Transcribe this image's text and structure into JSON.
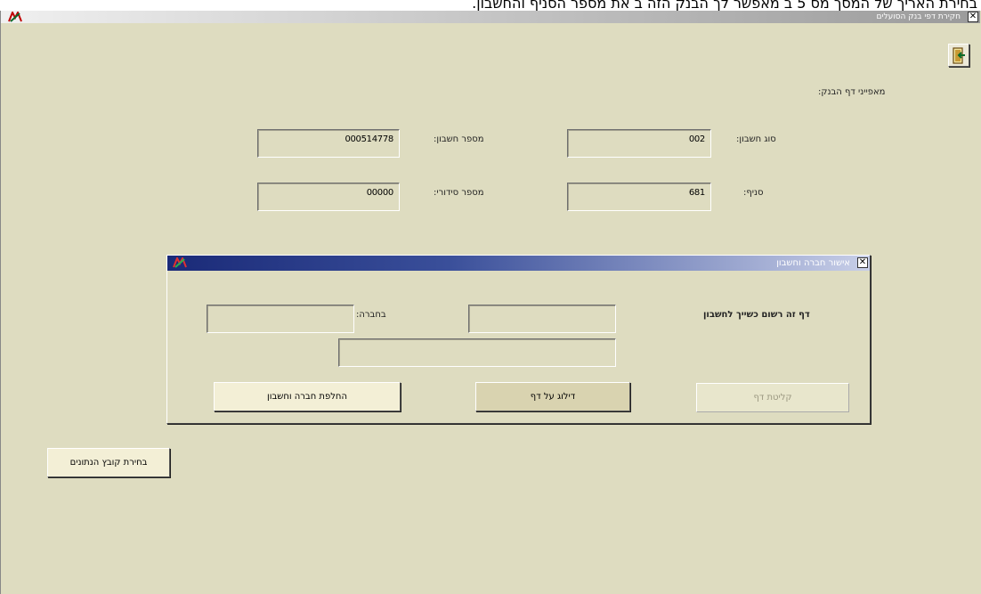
{
  "caption": "בחירת האריך של המסך מס 5 ב מאפשר לך הבנק הזה ב את מספר הסניף והחשבון.",
  "window": {
    "title": "חקירת דפי בנק הסועלים",
    "close_glyph": "✕"
  },
  "section_title": "מאפייני דף הבנק:",
  "fields": {
    "account_type": {
      "label": "סוג חשבון:",
      "value": "002"
    },
    "account_number": {
      "label": "מספר חשבון:",
      "value": "000514778"
    },
    "branch": {
      "label": "סניף:",
      "value": "681"
    },
    "serial_number": {
      "label": "מספר סידורי:",
      "value": "00000"
    }
  },
  "dialog": {
    "title": "אישור חברה וחשבון",
    "close_glyph": "✕",
    "prompt": "דף זה רשום כשייך לחשבון",
    "company_label": "בחברה:",
    "account_value": "",
    "company_value": "",
    "account_name_value": "",
    "buttons": {
      "accept_page": "קליטת דף",
      "skip_page": "דילוג על דף",
      "change_company_account": "החלפת חברה וחשבון"
    }
  },
  "data_file_button": "בחירת קובץ הנתונים",
  "colors": {
    "background": "#dedcc0",
    "dialog_title": "#1a2a78",
    "button_face": "#f3efd6"
  },
  "icons": {
    "exit": "door-exit-icon",
    "app_logo": "app-logo-icon",
    "close": "close-icon"
  }
}
